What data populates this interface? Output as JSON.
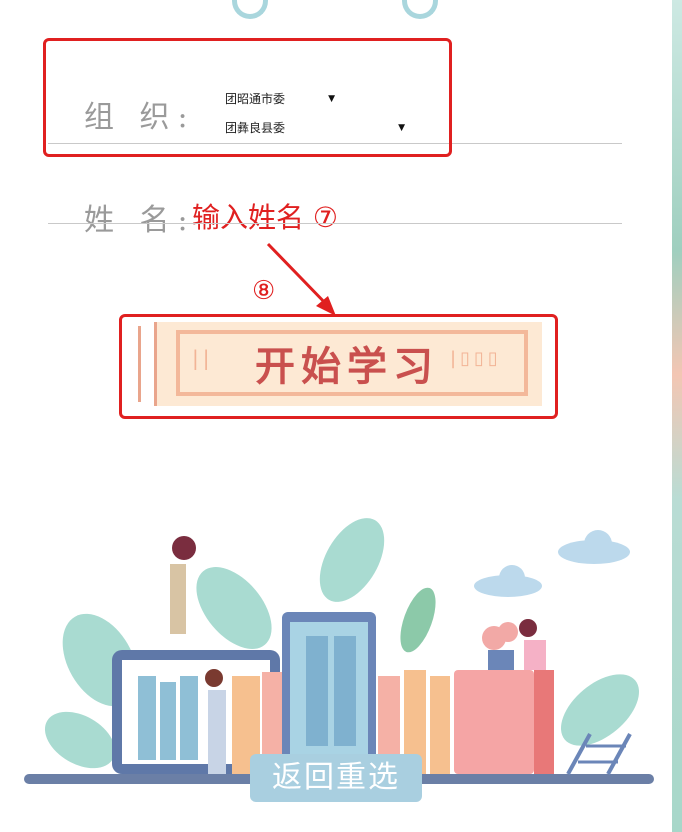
{
  "form": {
    "org_label": "组 织:",
    "org_select_1": "团昭通市委",
    "org_select_2": "团彝良县委",
    "name_label": "姓 名:"
  },
  "annotations": {
    "name_hint": "输入姓名 ⑦",
    "step_8": "⑧"
  },
  "buttons": {
    "start": "开始学习",
    "back": "返回重选"
  },
  "colors": {
    "annotation_red": "#e02020",
    "start_text": "#c9504e",
    "back_bg": "#a9cfe0"
  }
}
